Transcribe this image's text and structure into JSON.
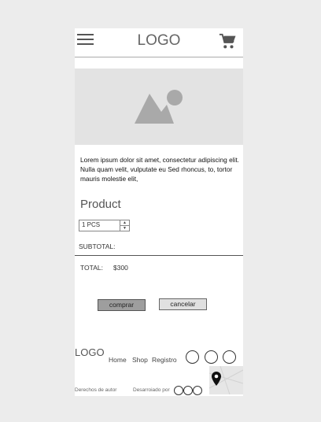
{
  "header": {
    "logo": "LOGO"
  },
  "description": "Lorem ipsum dolor sit amet, consectetur adipiscing elit. Nulla quam velit, vulputate eu Sed rhoncus, to, tortor mauris molestie elit,",
  "product": {
    "title": "Product",
    "quantity": "1 PCS",
    "subtotal_label": "SUBTOTAL:",
    "total_label": "TOTAL:",
    "total_value": "$300"
  },
  "actions": {
    "buy": "comprar",
    "cancel": "cancelar"
  },
  "footer": {
    "logo": "LOGO",
    "nav": [
      "Home",
      "Shop",
      "Registro"
    ],
    "copyright": "Derechos de autor",
    "developed_by": "Desarroiado por"
  },
  "icons": [
    "hamburger-menu-icon",
    "cart-icon",
    "image-placeholder-icon",
    "map-pin-icon"
  ]
}
